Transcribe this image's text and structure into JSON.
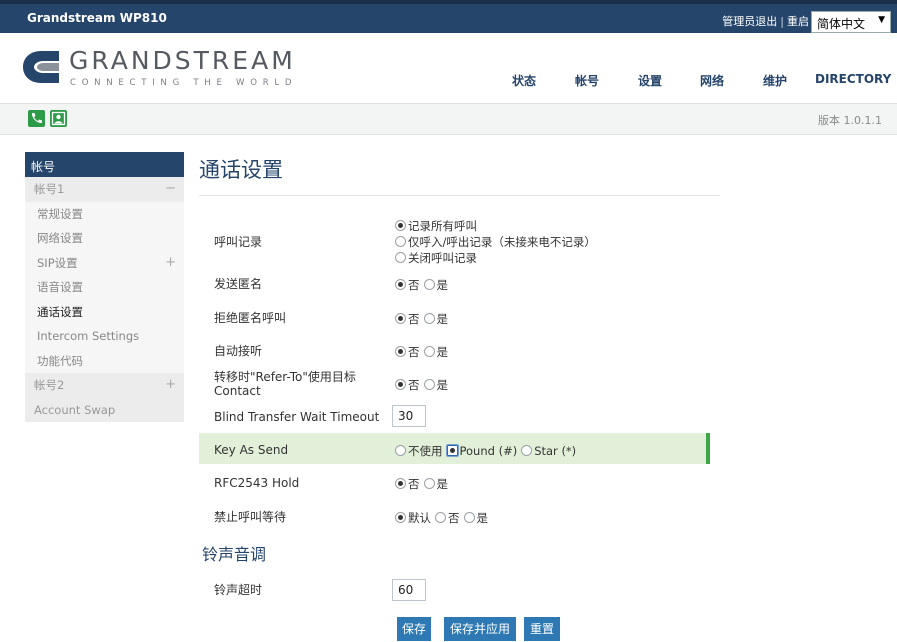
{
  "topbar": {
    "model": "Grandstream WP810",
    "logout": "管理员退出",
    "separator": "|",
    "reboot": "重启",
    "language": "简体中文",
    "language_arrow": "▼"
  },
  "logo": {
    "name": "GRANDSTREAM",
    "tagline": "CONNECTING THE WORLD"
  },
  "nav": [
    {
      "label": "状态"
    },
    {
      "label": "帐号"
    },
    {
      "label": "设置"
    },
    {
      "label": "网络"
    },
    {
      "label": "维护"
    },
    {
      "label": "DIRECTORY"
    }
  ],
  "version": "版本 1.0.1.1",
  "sidebar": {
    "header": "帐号",
    "account1": {
      "label": "帐号1",
      "toggle": "−"
    },
    "items": [
      {
        "label": "常规设置"
      },
      {
        "label": "网络设置"
      },
      {
        "label": "SIP设置",
        "toggle": "+"
      },
      {
        "label": "语音设置"
      },
      {
        "label": "通话设置"
      },
      {
        "label": "Intercom Settings"
      },
      {
        "label": "功能代码"
      }
    ],
    "account2": {
      "label": "帐号2",
      "toggle": "+"
    },
    "account_swap": "Account Swap"
  },
  "page": {
    "title": "通话设置",
    "call_log": {
      "label": "呼叫记录",
      "options": [
        "记录所有呼叫",
        "仅呼入/呼出记录（未接来电不记录）",
        "关闭呼叫记录"
      ],
      "selected": 0
    },
    "anon_send": {
      "label": "发送匿名",
      "options": [
        "否",
        "是"
      ],
      "selected": 0
    },
    "anon_reject": {
      "label": "拒绝匿名呼叫",
      "options": [
        "否",
        "是"
      ],
      "selected": 0
    },
    "auto_answer": {
      "label": "自动接听",
      "options": [
        "否",
        "是"
      ],
      "selected": 0
    },
    "refer_to": {
      "label_line1": "转移时\"Refer-To\"使用目标",
      "label_line2": "Contact",
      "options": [
        "否",
        "是"
      ],
      "selected": 0
    },
    "blind_transfer": {
      "label": "Blind Transfer Wait Timeout",
      "value": "30"
    },
    "key_as_send": {
      "label": "Key As Send",
      "options": [
        "不使用",
        "Pound (#)",
        "Star (*)"
      ],
      "selected": 1
    },
    "rfc2543": {
      "label": "RFC2543 Hold",
      "options": [
        "否",
        "是"
      ],
      "selected": 0
    },
    "call_waiting": {
      "label": "禁止呼叫等待",
      "options": [
        "默认",
        "否",
        "是"
      ],
      "selected": 0
    },
    "ring_section": "铃声音调",
    "ring_timeout": {
      "label": "铃声超时",
      "value": "60"
    }
  },
  "buttons": {
    "save": "保存",
    "save_apply": "保存并应用",
    "reset": "重置"
  },
  "colors": {
    "primary": "#26456b",
    "accent_green": "#3fa648",
    "button_blue": "#2e79b3",
    "highlight": "#e3f0d9"
  }
}
